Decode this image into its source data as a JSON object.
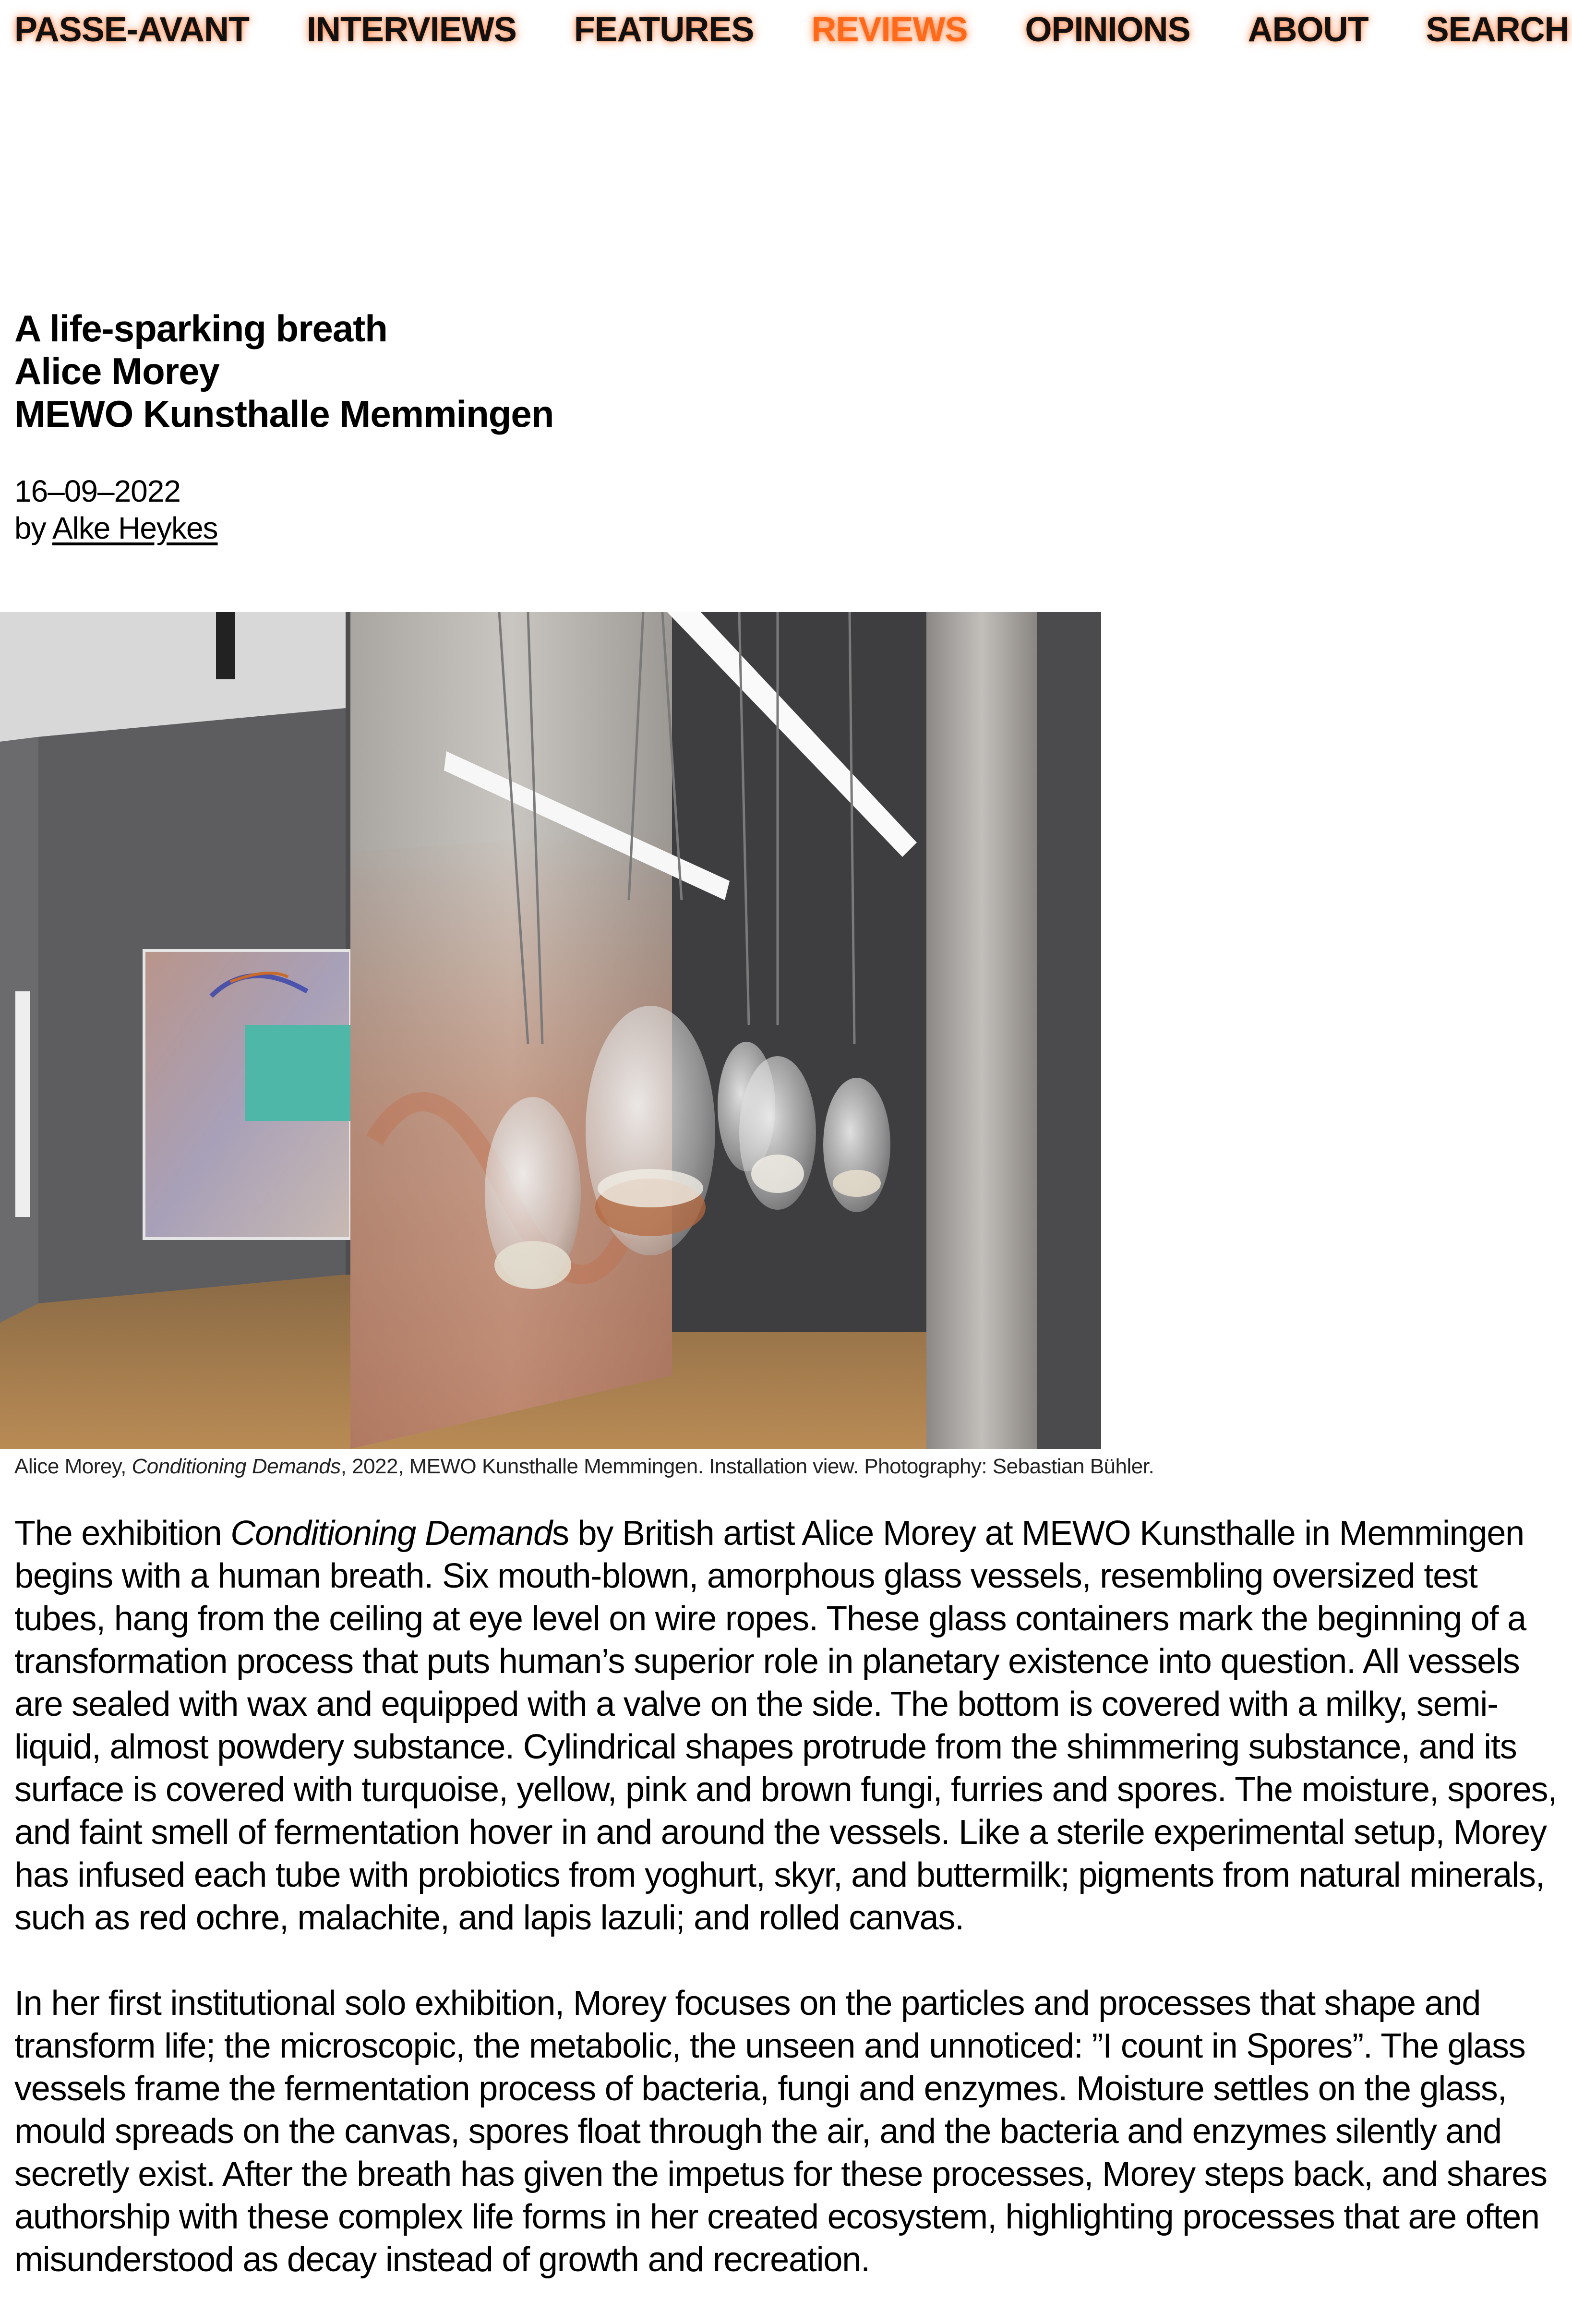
{
  "nav": {
    "items": [
      {
        "label": "PASSE-AVANT"
      },
      {
        "label": "INTERVIEWS"
      },
      {
        "label": "FEATURES"
      },
      {
        "label": "REVIEWS"
      },
      {
        "label": "OPINIONS"
      },
      {
        "label": "ABOUT"
      },
      {
        "label": "SEARCH"
      }
    ],
    "active": "REVIEWS",
    "accent_color": "#ff6a1a"
  },
  "article": {
    "title_lines": [
      "A life-sparking breath",
      "Alice Morey",
      "MEWO Kunsthalle Memmingen"
    ],
    "date": "16–09–2022",
    "by_prefix": "by ",
    "author": "Alke Heykes",
    "caption": {
      "prefix": "Alice Morey, ",
      "work": "Conditioning Demands",
      "suffix": ", 2022, MEWO Kunsthalle Memmingen. Installation view. Photography: Sebastian Bühler."
    },
    "paragraph1": {
      "before": "The exhibition ",
      "work": "Conditioning Demand",
      "after": "s by British artist Alice Morey at MEWO Kunsthalle in Memmingen begins with a human breath. Six mouth-blown, amorphous glass vessels, resembling oversized test tubes, hang from the ceiling at eye level on wire ropes. These glass containers mark the beginning of a transformation process that puts human’s superior role in planetary existence into question. All vessels are sealed with wax and equipped with a valve on the side. The bottom is covered with a milky, semi-liquid, almost powdery substance. Cylindrical shapes protrude from the shimmering substance, and its surface is covered with turquoise, yellow, pink and brown fungi, furries and spores. The moisture, spores, and faint smell of fermentation hover in and around the vessels. Like a sterile experimental setup, Morey has infused each tube with probiotics from yoghurt, skyr, and buttermilk; pigments from natural minerals, such as red ochre, malachite, and lapis lazuli; and rolled canvas."
    },
    "paragraph2": "In her first institutional solo exhibition, Morey focuses on the particles and processes that shape and transform life; the microscopic, the metabolic, the unseen and unnoticed: ”I count in Spores”. The glass vessels frame the fermentation process of bacteria, fungi and enzymes. Moisture settles on the glass, mould spreads on the canvas, spores float through the air, and the bacteria and enzymes silently and secretly exist. After the breath has given the impetus for these processes, Morey steps back, and shares authorship with these complex life forms in her created ecosystem, highlighting processes that are often misunderstood as decay instead of growth and recreation."
  }
}
